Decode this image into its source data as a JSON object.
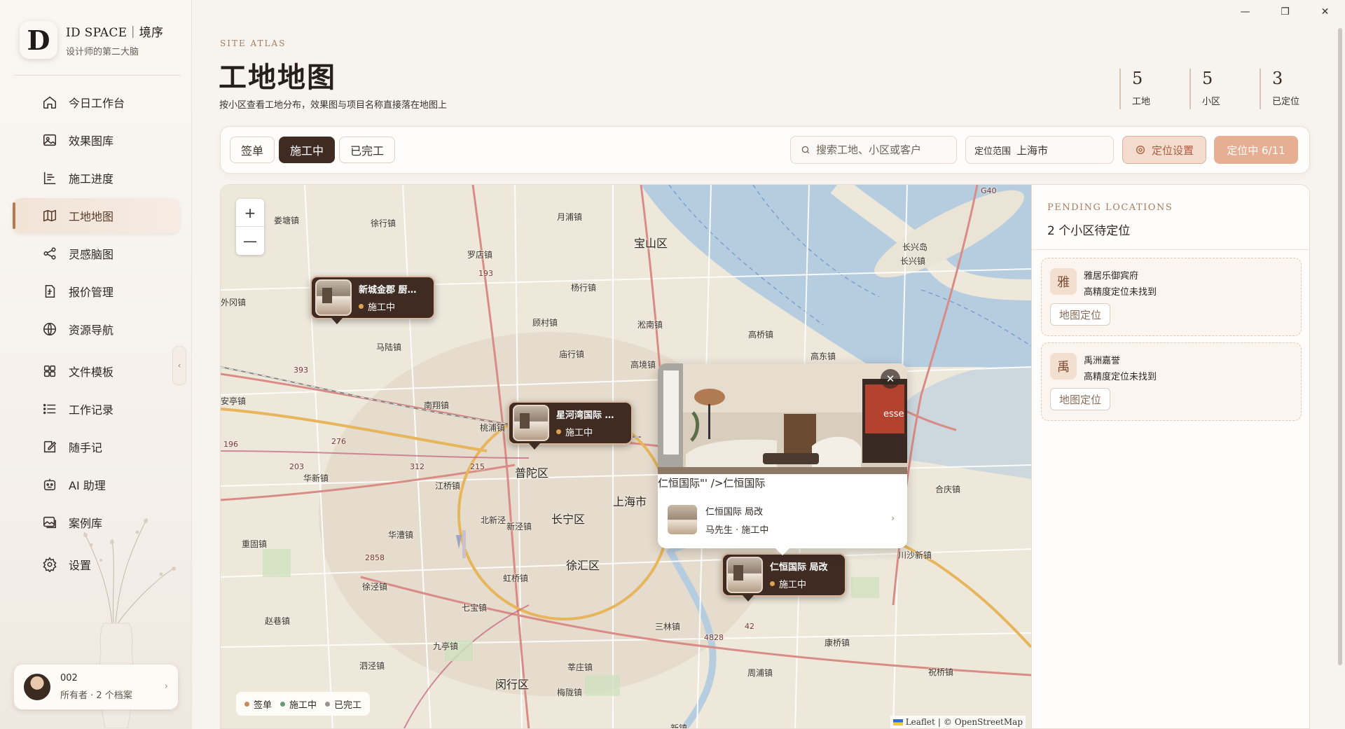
{
  "window": {
    "minimize": "—",
    "maximize": "❐",
    "close": "✕"
  },
  "brand": {
    "logo": "D",
    "title": "ID SPACE｜境序",
    "subtitle": "设计师的第二大脑"
  },
  "nav": {
    "items": [
      {
        "label": "今日工作台",
        "icon": "home-icon"
      },
      {
        "label": "效果图库",
        "icon": "image-icon"
      },
      {
        "label": "施工进度",
        "icon": "progress-icon"
      },
      {
        "label": "工地地图",
        "icon": "map-icon",
        "active": true
      },
      {
        "label": "灵感脑图",
        "icon": "share-nodes-icon"
      },
      {
        "label": "报价管理",
        "icon": "invoice-icon"
      },
      {
        "label": "资源导航",
        "icon": "globe-icon"
      },
      {
        "label": "文件模板",
        "icon": "grid-icon"
      },
      {
        "label": "工作记录",
        "icon": "list-icon"
      },
      {
        "label": "随手记",
        "icon": "edit-icon"
      },
      {
        "label": "AI 助理",
        "icon": "robot-icon"
      },
      {
        "label": "案例库",
        "icon": "gallery-icon"
      },
      {
        "label": "设置",
        "icon": "gear-icon"
      }
    ],
    "collapse": "‹"
  },
  "user": {
    "name": "002",
    "sub": "所有者 · 2 个档案",
    "chevron": "›"
  },
  "header": {
    "eyebrow": "SITE ATLAS",
    "title": "工地地图",
    "description": "按小区查看工地分布，效果图与项目名称直接落在地图上"
  },
  "stats": [
    {
      "value": "5",
      "label": "工地"
    },
    {
      "value": "5",
      "label": "小区"
    },
    {
      "value": "3",
      "label": "已定位"
    }
  ],
  "toolbar": {
    "tabs": [
      {
        "label": "签单",
        "active": false
      },
      {
        "label": "施工中",
        "active": true
      },
      {
        "label": "已完工",
        "active": false
      }
    ],
    "search_placeholder": "搜索工地、小区或客户",
    "range_label": "定位范围",
    "range_value": "上海市",
    "locate_settings": "定位设置",
    "locating": "定位中 6/11"
  },
  "map": {
    "zoom_in": "+",
    "zoom_out": "—",
    "places": [
      "月浦镇",
      "宝山区",
      "长兴岛",
      "长兴镇",
      "徐行镇",
      "娄塘镇",
      "罗店镇",
      "杨行镇",
      "淞南镇",
      "高桥镇",
      "外冈镇",
      "顾村镇",
      "庙行镇",
      "高东镇",
      "高境镇",
      "马陆镇",
      "安亭镇",
      "南翔镇",
      "桃浦镇",
      "普陀区",
      "上海市",
      "江桥镇",
      "华新镇",
      "长宁区",
      "北新泾",
      "新泾镇",
      "华漕镇",
      "徐汇区",
      "虹桥镇",
      "重固镇",
      "徐泾镇",
      "七宝镇",
      "赵巷镇",
      "九亭镇",
      "三林镇",
      "川沙新镇",
      "合庆镇",
      "康桥镇",
      "泗泾镇",
      "莘庄镇",
      "闵行区",
      "梅陇镇",
      "周浦镇",
      "祝桥镇",
      "新镇"
    ],
    "roads": [
      "G40",
      "193",
      "276",
      "203",
      "215",
      "312",
      "4828",
      "2858",
      "42",
      "393",
      "196"
    ],
    "pins": [
      {
        "title": "新城金郡 厨…",
        "status": "施工中"
      },
      {
        "title": "星河湾国际 …",
        "status": "施工中"
      },
      {
        "title": "仁恒国际 局改",
        "status": "施工中"
      }
    ],
    "popup": {
      "close": "✕",
      "caption": "仁恒国际\"' />仁恒国际",
      "name": "仁恒国际 局改",
      "sub": "马先生 · 施工中",
      "chevron": "›",
      "art_text": "esse"
    },
    "legend": [
      {
        "label": "签单",
        "color": "#c78a5e"
      },
      {
        "label": "施工中",
        "color": "#6a9a78"
      },
      {
        "label": "已完工",
        "color": "#9a9390"
      }
    ],
    "attribution": {
      "leaflet": "Leaflet",
      "sep": "|",
      "osm": "© OpenStreetMap"
    }
  },
  "pending": {
    "eyebrow": "PENDING LOCATIONS",
    "title": "2 个小区待定位",
    "items": [
      {
        "badge": "雅",
        "name": "雅居乐御宾府",
        "message": "高精度定位未找到",
        "action": "地图定位"
      },
      {
        "badge": "禹",
        "name": "禹洲嘉誉",
        "message": "高精度定位未找到",
        "action": "地图定位"
      }
    ]
  },
  "colors": {
    "accent": "#b47a55",
    "dark": "#3f2b22",
    "status_active": "#e0a24e"
  }
}
